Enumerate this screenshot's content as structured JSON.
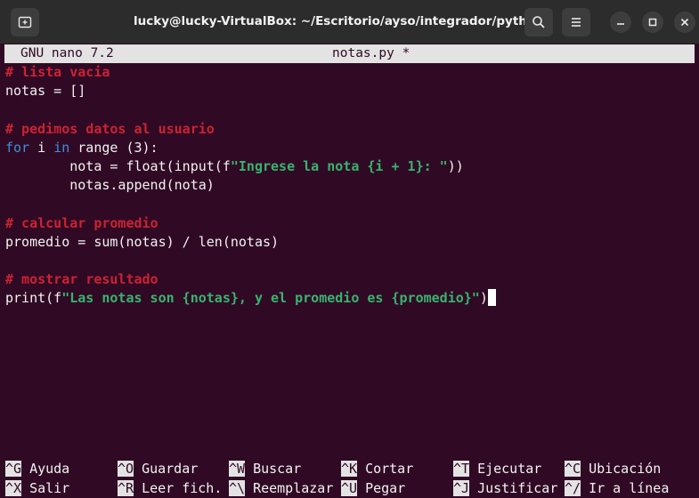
{
  "window": {
    "title": "lucky@lucky-VirtualBox: ~/Escritorio/ayso/integrador/python"
  },
  "nano": {
    "version": "GNU nano 7.2",
    "filename": "notas.py *"
  },
  "code_lines": [
    [
      {
        "t": "# lista vacia",
        "c": "comment"
      }
    ],
    [
      {
        "t": "notas = []",
        "c": "plain"
      }
    ],
    [],
    [
      {
        "t": "# pedimos datos al usuario",
        "c": "comment"
      }
    ],
    [
      {
        "t": "for",
        "c": "kw"
      },
      {
        "t": " i ",
        "c": "plain"
      },
      {
        "t": "in",
        "c": "kw"
      },
      {
        "t": " range (3):",
        "c": "plain"
      }
    ],
    [
      {
        "t": "        nota = float(input(f",
        "c": "plain"
      },
      {
        "t": "\"Ingrese la nota {i + 1}: \"",
        "c": "str"
      },
      {
        "t": "))",
        "c": "plain"
      }
    ],
    [
      {
        "t": "        notas.append(nota)",
        "c": "plain"
      }
    ],
    [],
    [
      {
        "t": "# calcular promedio",
        "c": "comment"
      }
    ],
    [
      {
        "t": "promedio = sum(notas) / len(notas)",
        "c": "plain"
      }
    ],
    [],
    [
      {
        "t": "# mostrar resultado",
        "c": "comment"
      }
    ],
    [
      {
        "t": "print(f",
        "c": "plain"
      },
      {
        "t": "\"Las notas son {notas}, y el promedio es {promedio}\"",
        "c": "str"
      },
      {
        "t": ")",
        "c": "plain"
      },
      {
        "t": "",
        "c": "cursor"
      }
    ]
  ],
  "shortcuts_row1": [
    {
      "key": "^G",
      "label": "Ayuda"
    },
    {
      "key": "^O",
      "label": "Guardar"
    },
    {
      "key": "^W",
      "label": "Buscar"
    },
    {
      "key": "^K",
      "label": "Cortar"
    },
    {
      "key": "^T",
      "label": "Ejecutar"
    },
    {
      "key": "^C",
      "label": "Ubicación"
    }
  ],
  "shortcuts_row2": [
    {
      "key": "^X",
      "label": "Salir"
    },
    {
      "key": "^R",
      "label": "Leer fich."
    },
    {
      "key": "^\\",
      "label": "Reemplazar"
    },
    {
      "key": "^U",
      "label": "Pegar"
    },
    {
      "key": "^J",
      "label": "Justificar"
    },
    {
      "key": "^/",
      "label": "Ir a línea"
    }
  ],
  "icons": {
    "new_tab": "new-tab-icon",
    "search": "search-icon",
    "menu": "hamburger-menu-icon",
    "minimize": "minimize-icon",
    "maximize": "maximize-icon",
    "close": "close-icon"
  }
}
